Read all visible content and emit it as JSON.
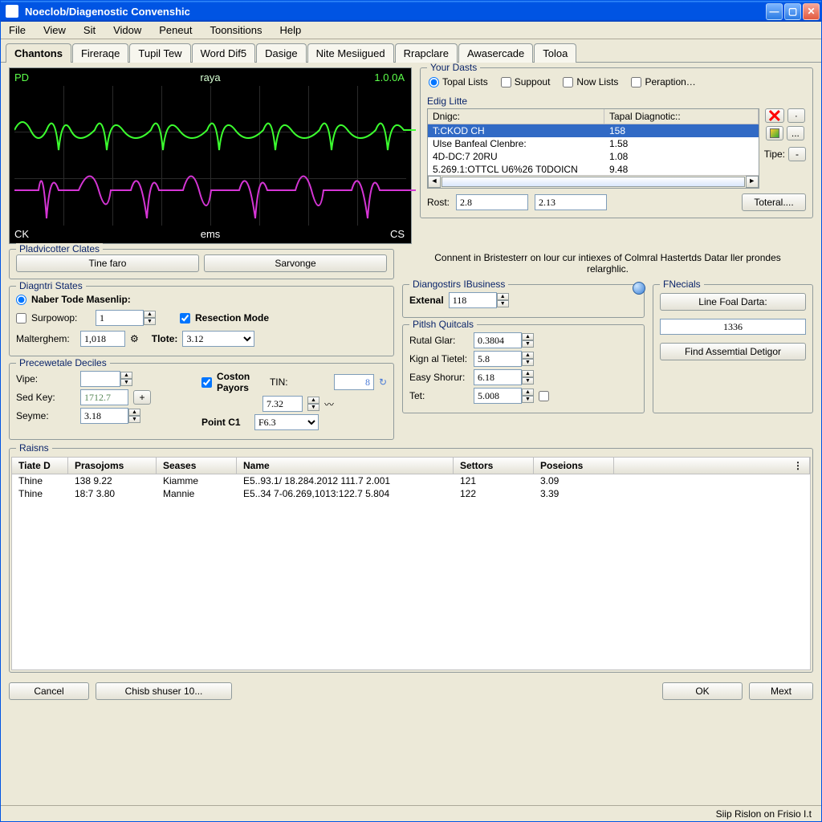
{
  "window": {
    "title": "Noeclob/Diagenostic Convenshic"
  },
  "menu": {
    "file": "File",
    "view": "View",
    "sit": "Sit",
    "vidow": "Vidow",
    "peneut": "Peneut",
    "toonsitions": "Toonsitions",
    "help": "Help"
  },
  "tabs": [
    {
      "label": "Chantons",
      "active": true
    },
    {
      "label": "Fireraqe"
    },
    {
      "label": "Tupil Tew"
    },
    {
      "label": "Word Dif5"
    },
    {
      "label": "Dasige"
    },
    {
      "label": "Nite Mesiigued"
    },
    {
      "label": "Rrapclare"
    },
    {
      "label": "Awasercade"
    },
    {
      "label": "Toloa"
    }
  ],
  "scope": {
    "title": "raya",
    "tl": "PD",
    "tr": "1.0.0A",
    "bl": "CK",
    "bm": "ems",
    "br": "CS"
  },
  "your_dasts": {
    "legend": "Your Dasts",
    "radios": [
      "Topal Lists",
      "Suppout",
      "Now Lists",
      "Peraption…"
    ],
    "edig_litte": "Edig Litte",
    "col1": "Dnigc:",
    "col2": "Tapal Diagnotic::",
    "rows": [
      {
        "c1": "T:CKOD CH",
        "c2": "158",
        "sel": true
      },
      {
        "c1": "Ulse Banfeal Clenbre:",
        "c2": "1.58"
      },
      {
        "c1": "4D-DC:7 20RU",
        "c2": "1.08"
      },
      {
        "c1": "5.269.1:OTTCL U6%26 T0DOICN",
        "c2": "9.48"
      }
    ],
    "rost_label": "Rost:",
    "rost_v1": "2.8",
    "rost_v2": "2.13",
    "toteral": "Toteral....",
    "tipe_label": "Tipe:"
  },
  "pladvicotter": {
    "legend": "Pladvicotter Clates",
    "btn1": "Tine faro",
    "btn2": "Sarvonge"
  },
  "comment": "Connent in Bristesterr on lour cur intiexes of Colmral Hastertds Datar ller prondes relarghlic.",
  "diagntri": {
    "legend": "Diagntri States",
    "naber": "Naber Tode Masenlip:",
    "surpowop": "Surpowop:",
    "surpowop_val": "1",
    "resection": "Resection Mode",
    "malterghem": "Malterghem:",
    "malterghem_val": "1,018",
    "tlote": "Tlote:",
    "tlote_val": "3.12"
  },
  "prec": {
    "legend": "Precewetale Deciles",
    "vipe": "Vipe:",
    "coston": "Coston Payors",
    "tini": "TIN:",
    "tini_val": "8",
    "sed": "Sed Key:",
    "sed_val": "1712.7",
    "seyme": "Seyme:",
    "seyme_val": "3.18",
    "box": "7.32",
    "pointc1": "Point C1",
    "pointc1_val": "F6.3"
  },
  "diagnostirs": {
    "legend": "Diangostirs IBusiness",
    "extenal": "Extenal",
    "extenal_val": "118"
  },
  "pitish": {
    "legend": "Pitlsh Quitcals",
    "rutal": "Rutal Glar:",
    "rutal_val": "0.3804",
    "kign": "Kign al Tietel:",
    "kign_val": "5.8",
    "easy": "Easy Shorur:",
    "easy_val": "6.18",
    "tet": "Tet:",
    "tet_val": "5.008"
  },
  "pnecials": {
    "legend": "FNecials",
    "btn_line": "Line Foal Darta:",
    "val": "1336",
    "btn_find": "Find Assemtial Detigor"
  },
  "raisns": {
    "legend": "Raisns",
    "cols": [
      "Tiate D",
      "Prasojoms",
      "Seases",
      "Name",
      "Settors",
      "Poseions"
    ],
    "widths": [
      70,
      110,
      100,
      270,
      100,
      100
    ],
    "rows": [
      [
        "Thine",
        "138 9.22",
        "Kiamme",
        "E5..93.1/ 18.284.2012 111.7 2.001",
        "121",
        "3.09"
      ],
      [
        "Thine",
        "18:7 3.80",
        "Mannie",
        "E5..34 7-06.269,1013:122.7 5.804",
        "122",
        "3.39"
      ]
    ]
  },
  "bottom": {
    "cancel": "Cancel",
    "chisb": "Chisb shuser 10...",
    "ok": "OK",
    "mext": "Mext"
  },
  "statusbar": "Siip Rislon on Frisio I.t"
}
